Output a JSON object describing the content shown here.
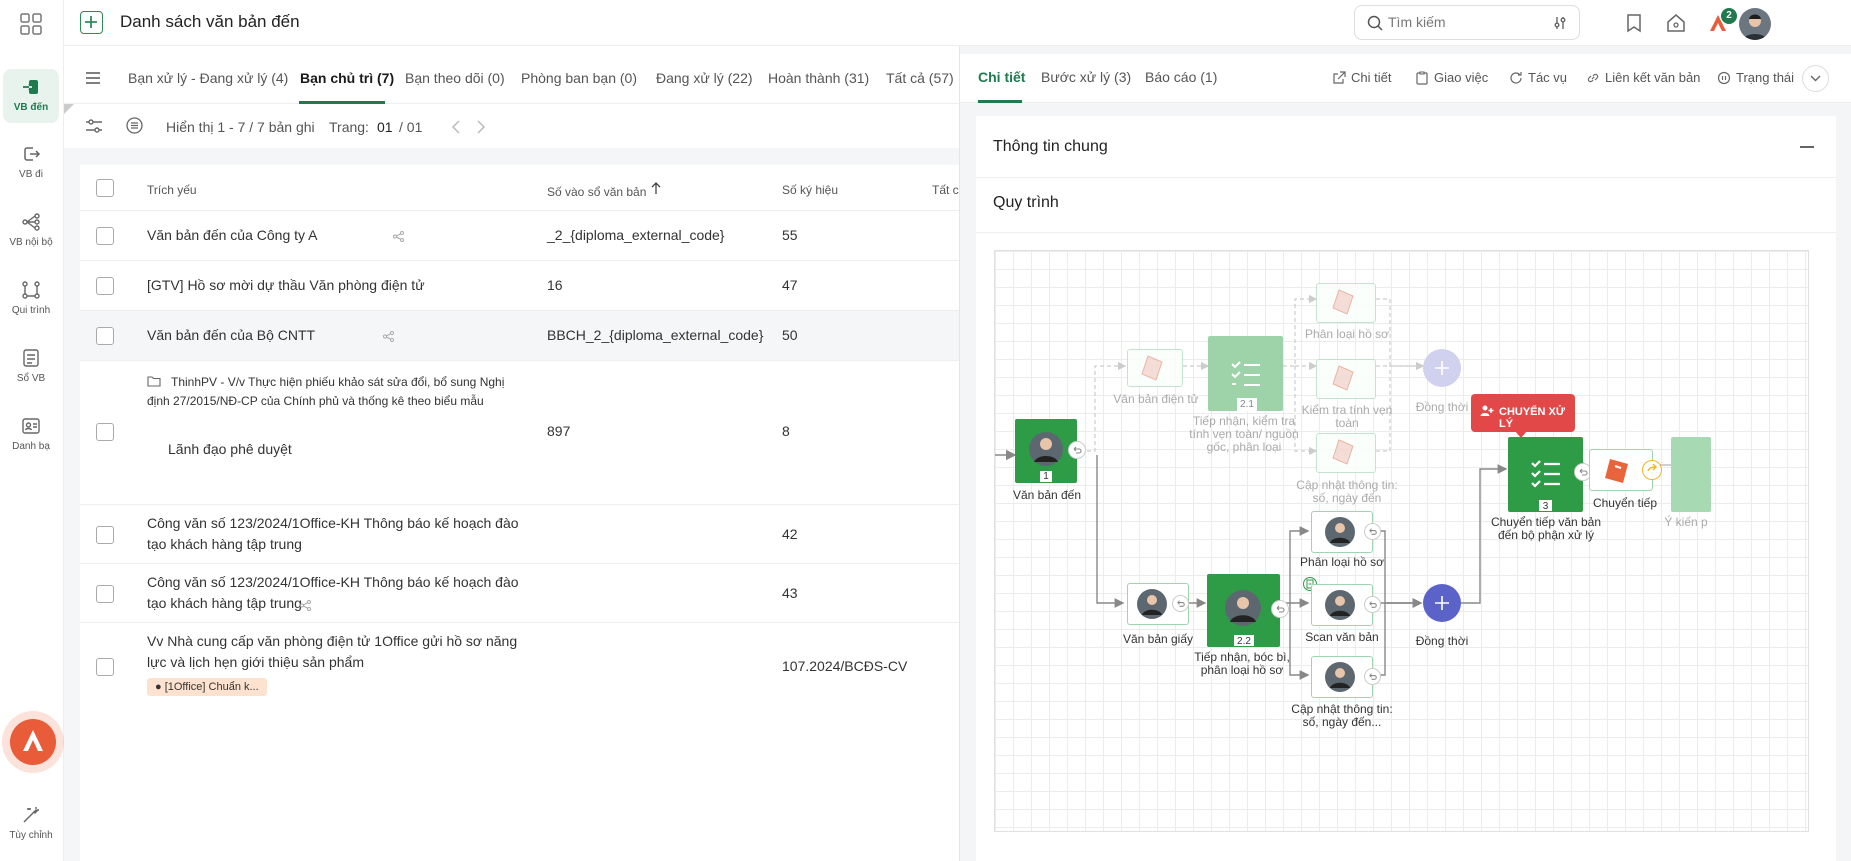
{
  "rail": {
    "items": [
      {
        "label": "VB đến",
        "icon": "incoming-doc-icon"
      },
      {
        "label": "VB đi",
        "icon": "outgoing-doc-icon"
      },
      {
        "label": "VB nội bộ",
        "icon": "internal-doc-icon"
      },
      {
        "label": "Qui trình",
        "icon": "workflow-icon"
      },
      {
        "label": "Sổ VB",
        "icon": "book-icon"
      },
      {
        "label": "Danh bạ",
        "icon": "contacts-icon"
      }
    ],
    "customize": "Tùy chỉnh"
  },
  "header": {
    "title": "Danh sách văn bản đến",
    "search_placeholder": "Tìm kiếm",
    "notification_badge": "2"
  },
  "list": {
    "tabs": [
      "Bạn xử lý - Đang xử lý (4)",
      "Bạn chủ trì (7)",
      "Bạn theo dõi (0)",
      "Phòng ban bạn (0)",
      "Đang xử lý (22)",
      "Hoàn thành (31)",
      "Tất cả (57)"
    ],
    "active_tab": 1,
    "display_text": "Hiển thị 1 - 7 / 7 bản ghi",
    "page_label": "Trang:",
    "page_current": "01",
    "page_total": "/ 01",
    "columns": [
      "Trích yếu",
      "Số vào sổ văn bản",
      "Số ký hiệu",
      "Tất cả"
    ],
    "rows": [
      {
        "summary": "Văn bản đến của Công ty A",
        "book_no": "_2_{diploma_external_code}",
        "symbol": "55"
      },
      {
        "summary": "[GTV] Hồ sơ mời dự thầu Văn phòng điện tử",
        "book_no": "16",
        "symbol": "47"
      },
      {
        "summary": "Văn bản đến của Bộ CNTT",
        "book_no": "BBCH_2_{diploma_external_code}",
        "symbol": "50"
      },
      {
        "summary": "ThinhPV - V/v Thực hiện phiếu khảo sát sửa đổi, bổ sung Nghị định 27/2015/NĐ-CP của Chính phủ và thống kê theo biểu mẫu",
        "sub": "Lãnh đạo phê duyệt",
        "book_no": "897",
        "symbol": "8"
      },
      {
        "summary": "Công văn số 123/2024/1Office-KH Thông báo kế hoạch đào tạo khách hàng tập trung",
        "book_no": "",
        "symbol": "42"
      },
      {
        "summary": "Công văn số 123/2024/1Office-KH Thông báo kế hoạch đào tạo khách hàng tập trung",
        "book_no": "",
        "symbol": "43"
      },
      {
        "summary": "Vv Nhà cung cấp văn phòng điện tử 1Office gửi hồ sơ năng lực và lịch hẹn giới thiệu sản phẩm",
        "tag": "[1Office] Chuẩn k...",
        "book_no": "",
        "symbol": "107.2024/BCĐS-CV"
      }
    ]
  },
  "detail": {
    "tabs": [
      "Chi tiết",
      "Bước xử lý (3)",
      "Báo cáo (1)"
    ],
    "actions": [
      "Chi tiết",
      "Giao việc",
      "Tác vụ",
      "Liên kết văn bản",
      "Trạng thái"
    ],
    "section_general": "Thông tin chung",
    "section_process": "Quy trình",
    "flow": {
      "chip": "CHUYỂN XỬ LÝ",
      "labels": {
        "van_ban_den": "Văn bản đến",
        "van_ban_dien_tu": "Văn bản điện tử",
        "tiep_nhan_kiem_tra": "Tiếp nhận, kiểm tra tính vẹn toàn/ nguồn gốc, phân loại",
        "phan_loai_ho_so_top": "Phân loại hồ sơ",
        "kiem_tra_tinh_ven_toan": "Kiểm tra tính vẹn toàn",
        "cap_nhat_top": "Cập nhật thông tin: số, ngày đến",
        "dong_thoi_top": "Đồng thời",
        "chuyen_tiep_vb": "Chuyển tiếp văn bản đến bộ phận xử lý",
        "chuyen_tiep": "Chuyển tiếp",
        "y_kien": "Ý kiến p",
        "van_ban_giay": "Văn bản giấy",
        "tiep_nhan_boc_bi": "Tiếp nhận, bóc bì, phân loại hồ sơ",
        "phan_loai_ho_so_bot": "Phân loại hồ sơ",
        "scan_van_ban": "Scan văn bản",
        "cap_nhat_bot": "Cập nhật thông tin: số, ngày đến...",
        "dong_thoi_bot": "Đồng thời"
      },
      "step_numbers": {
        "n1": "1",
        "n21": "2.1",
        "n22": "2.2",
        "n3": "3"
      }
    }
  },
  "colors": {
    "accent": "#1f7a4d",
    "node_green": "#2e9b46",
    "merge": "#5b63c8",
    "brand": "#e85c3a",
    "chip": "#e24848"
  }
}
